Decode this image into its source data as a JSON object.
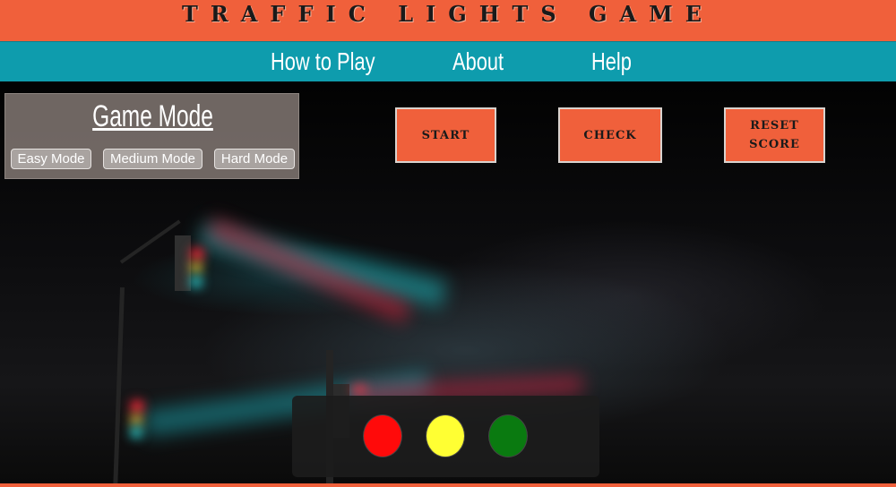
{
  "header": {
    "title": "Traffic Lights Game",
    "background_color": "#f0603b"
  },
  "nav": {
    "background_color": "#0e9cad",
    "links": [
      {
        "label": "How to Play"
      },
      {
        "label": "About"
      },
      {
        "label": "Help"
      }
    ]
  },
  "game_mode": {
    "title": "Game Mode",
    "modes": [
      {
        "label": "Easy Mode"
      },
      {
        "label": "Medium Mode"
      },
      {
        "label": "Hard Mode"
      }
    ]
  },
  "controls": {
    "start_label": "Start",
    "check_label": "Check",
    "reset_label_line1": "Reset",
    "reset_label_line2": "Score",
    "button_color": "#f0603b"
  },
  "traffic_light": {
    "lights": [
      {
        "name": "red",
        "color": "#ff0a0a"
      },
      {
        "name": "yellow",
        "color": "#ffff33"
      },
      {
        "name": "green",
        "color": "#0a7a10"
      }
    ]
  },
  "background_image": {
    "subject": "foggy-night-traffic-lights"
  }
}
